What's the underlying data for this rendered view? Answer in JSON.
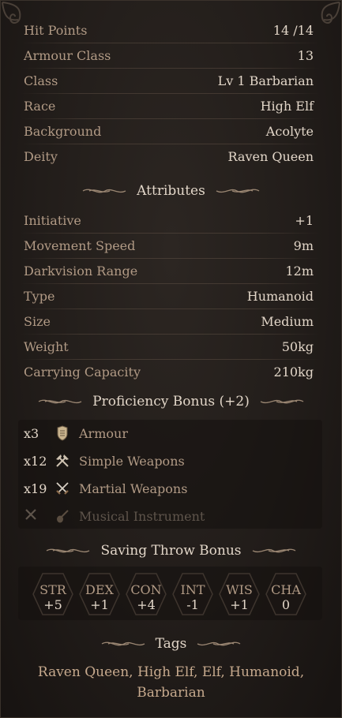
{
  "stats": [
    {
      "label": "Hit Points",
      "value": "14 /14"
    },
    {
      "label": "Armour Class",
      "value": "13"
    },
    {
      "label": "Class",
      "value": "Lv 1 Barbarian"
    },
    {
      "label": "Race",
      "value": "High Elf"
    },
    {
      "label": "Background",
      "value": "Acolyte"
    },
    {
      "label": "Deity",
      "value": "Raven Queen"
    }
  ],
  "attributes_header": "Attributes",
  "attributes": [
    {
      "label": "Initiative",
      "value": "+1"
    },
    {
      "label": "Movement Speed",
      "value": "9m"
    },
    {
      "label": "Darkvision Range",
      "value": "12m"
    },
    {
      "label": "Type",
      "value": "Humanoid"
    },
    {
      "label": "Size",
      "value": "Medium"
    },
    {
      "label": "Weight",
      "value": "50kg"
    },
    {
      "label": "Carrying Capacity",
      "value": "210kg"
    }
  ],
  "proficiency_header": "Proficiency Bonus (+2)",
  "proficiencies": [
    {
      "count": "x3",
      "icon": "armour-icon",
      "name": "Armour",
      "active": true
    },
    {
      "count": "x12",
      "icon": "simple-weapons-icon",
      "name": "Simple Weapons",
      "active": true
    },
    {
      "count": "x19",
      "icon": "martial-weapons-icon",
      "name": "Martial Weapons",
      "active": true
    },
    {
      "count": "",
      "icon": "musical-instrument-icon",
      "name": "Musical Instrument",
      "active": false
    }
  ],
  "saving_header": "Saving Throw Bonus",
  "saving_throws": [
    {
      "ability": "STR",
      "bonus": "+5"
    },
    {
      "ability": "DEX",
      "bonus": "+1"
    },
    {
      "ability": "CON",
      "bonus": "+4"
    },
    {
      "ability": "INT",
      "bonus": "-1"
    },
    {
      "ability": "WIS",
      "bonus": "+1"
    },
    {
      "ability": "CHA",
      "bonus": "0"
    }
  ],
  "tags_header": "Tags",
  "tags_text": "Raven Queen, High Elf, Elf, Humanoid, Barbarian",
  "colors": {
    "label": "#b19a85",
    "value": "#e2d6c8",
    "tags": "#c6a98d",
    "background": "#221d1a"
  }
}
